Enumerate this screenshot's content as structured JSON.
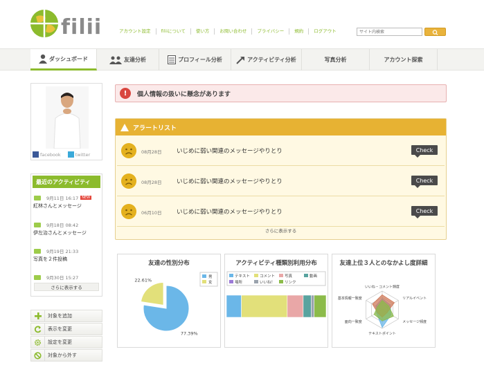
{
  "brand": {
    "name": "filii"
  },
  "topnav": [
    "アカウント設定",
    "filiiについて",
    "使い方",
    "お問い合わせ",
    "プライバシー",
    "規約",
    "ログアウト"
  ],
  "search": {
    "placeholder": "サイト内検索"
  },
  "mainnav": [
    {
      "label": "ダッシュボード",
      "icon": "user-icon",
      "active": true
    },
    {
      "label": "友達分析",
      "icon": "people-icon",
      "active": false
    },
    {
      "label": "プロフィール分析",
      "icon": "profile-card-icon",
      "active": false
    },
    {
      "label": "アクティビティ分析",
      "icon": "activity-arrow-icon",
      "active": false
    },
    {
      "label": "写真分析",
      "icon": "",
      "active": false
    },
    {
      "label": "アカウント探索",
      "icon": "",
      "active": false
    }
  ],
  "profile": {
    "facebook": "facebook",
    "twitter": "twitter"
  },
  "activity": {
    "title": "最近のアクティビティ",
    "items": [
      {
        "time": "9月11日 16:17",
        "text": "紅林さんとメッセージ",
        "new": "NEW"
      },
      {
        "time": "9月18日 08:42",
        "text": "伊左治さんとメッセージ"
      },
      {
        "time": "9月19日 21:33",
        "text": "写真を２件投稿"
      },
      {
        "time": "9月30日 15:27",
        "text": ""
      }
    ],
    "more": "さらに表示する"
  },
  "actions": [
    {
      "label": "対象を追加",
      "icon": "plus-icon",
      "color": "#8cbb2d"
    },
    {
      "label": "表示を変更",
      "icon": "refresh-icon",
      "color": "#8cbb2d"
    },
    {
      "label": "設定を変更",
      "icon": "gear-icon",
      "color": "#8cbb2d"
    },
    {
      "label": "対象から外す",
      "icon": "prohibit-icon",
      "color": "#8cbb2d"
    }
  ],
  "concern": {
    "text": "個人情報の扱いに懸念があります",
    "icon": "!"
  },
  "alerts": {
    "title": "アラートリスト",
    "items": [
      {
        "date": "08月28日",
        "message": "いじめに弱い関連のメッセージやりとり",
        "button": "Check"
      },
      {
        "date": "08月28日",
        "message": "いじめに弱い関連のメッセージやりとり",
        "button": "Check"
      },
      {
        "date": "06月10日",
        "message": "いじめに弱い関連のメッセージやりとり",
        "button": "Check"
      }
    ],
    "more": "さらに表示する"
  },
  "colors": {
    "brand": "#8cbb2d",
    "alert": "#e7b233",
    "danger": "#d9463f"
  },
  "chart_data": [
    {
      "type": "pie",
      "title": "友達の性別分布",
      "labels": [
        "男",
        "女"
      ],
      "values": [
        77.39,
        22.61
      ],
      "display": [
        "77.39%",
        "22.61%"
      ],
      "colors": [
        "#6bb7e8",
        "#e2e07a"
      ],
      "legend": "top-right"
    },
    {
      "type": "bar",
      "title": "アクティビティ種類別利用分布",
      "orientation": "horizontal-stacked",
      "legend_rows": [
        [
          "テキスト",
          "コメント",
          "写真",
          "動画"
        ],
        [
          "場所",
          "いいね！",
          "リンク"
        ]
      ],
      "series": [
        {
          "name": "テキスト",
          "value": 15,
          "color": "#6bb7e8"
        },
        {
          "name": "コメント",
          "value": 46,
          "color": "#e2e07a"
        },
        {
          "name": "写真",
          "value": 16,
          "color": "#e9a7a7"
        },
        {
          "name": "動画",
          "value": 8,
          "color": "#59a39f"
        },
        {
          "name": "場所",
          "value": 0,
          "color": "#9b7ad6"
        },
        {
          "name": "いいね！",
          "value": 3,
          "color": "#9aa3ad"
        },
        {
          "name": "リンク",
          "value": 12,
          "color": "#8cbb4a"
        }
      ]
    },
    {
      "type": "radar",
      "title": "友達上位３人とのなかよし度詳細",
      "axes": [
        "いいね・コメント頻度",
        "リアルイベント",
        "メッセージ頻度",
        "テキストポイント",
        "面向一致度",
        "基本情報一致度"
      ],
      "series": [
        {
          "color": "#6bb7e8",
          "values": [
            0.6,
            0.5,
            0.55,
            0.95,
            0.35,
            0.4
          ]
        },
        {
          "color": "#d07a5a",
          "values": [
            0.8,
            0.75,
            0.3,
            0.4,
            0.3,
            0.6
          ]
        },
        {
          "color": "#8cbb4a",
          "values": [
            0.5,
            0.4,
            0.7,
            0.6,
            0.5,
            0.3
          ]
        }
      ]
    }
  ]
}
